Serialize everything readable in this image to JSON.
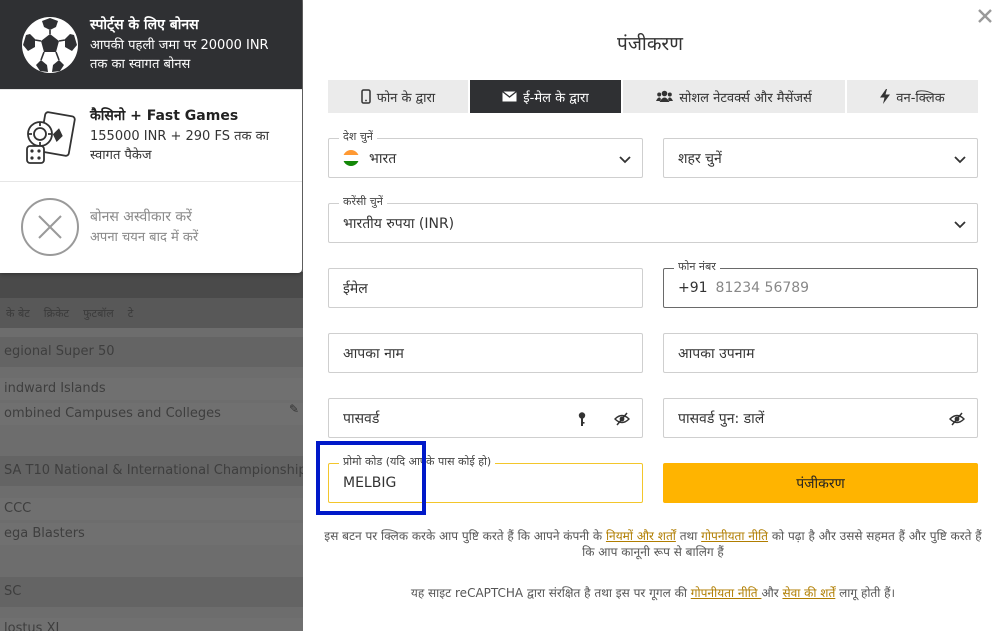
{
  "background": {
    "nav": [
      "के बेट",
      "क्रिकेट",
      "फुटबॉल",
      "टे"
    ],
    "rows": [
      {
        "type": "head",
        "text": "egional Super 50"
      },
      {
        "type": "item",
        "text": "indward Islands"
      },
      {
        "type": "item",
        "text": "ombined Campuses and Colleges"
      },
      {
        "type": "head",
        "text": "SA T10 National & International Championship"
      },
      {
        "type": "item",
        "text": "CCC"
      },
      {
        "type": "item",
        "text": "ega Blasters"
      },
      {
        "type": "head",
        "text": "SC"
      },
      {
        "type": "item",
        "text": "lostus XI"
      }
    ]
  },
  "bonus_panel": {
    "items": [
      {
        "title": "स्पोर्ट्स के लिए बोनस",
        "desc1": "आपकी पहली जमा पर 20000 INR",
        "desc2": "तक का स्वागत बोनस",
        "icon": "soccer-ball-icon",
        "active": true
      },
      {
        "title": "कैसिनो + Fast Games",
        "desc1": "155000 INR + 290 FS तक का",
        "desc2": "स्वागत पैकेज",
        "icon": "casino-icon",
        "active": false
      },
      {
        "title": "बोनस अस्वीकार करें",
        "desc1": "अपना चयन बाद में करें",
        "icon": "decline-x-icon",
        "active": false
      }
    ]
  },
  "modal": {
    "title": "पंजीकरण",
    "tabs": [
      {
        "label": "फोन के द्वारा",
        "icon": "phone-icon"
      },
      {
        "label": "ई-मेल के द्वारा",
        "icon": "envelope-icon",
        "active": true
      },
      {
        "label": "सोशल नेटवर्क्स और मैसेंजर्स",
        "icon": "users-icon"
      },
      {
        "label": "वन-क्लिक",
        "icon": "lightning-icon"
      }
    ],
    "fields": {
      "country": {
        "label": "देश चुनें",
        "value": "भारत"
      },
      "city": {
        "placeholder": "शहर चुनें"
      },
      "currency": {
        "label": "करेंसी चुनें",
        "value": "भारतीय रुपया (INR)"
      },
      "email": {
        "placeholder": "ईमेल"
      },
      "phone": {
        "label": "फोन नंबर",
        "prefix": "+91",
        "placeholder": "81234 56789"
      },
      "first_name": {
        "placeholder": "आपका नाम"
      },
      "last_name": {
        "placeholder": "आपका उपनाम"
      },
      "password": {
        "placeholder": "पासवर्ड"
      },
      "password_repeat": {
        "placeholder": "पासवर्ड पुन: डालें"
      },
      "promo": {
        "label": "प्रोमो कोड (यदि आपके पास कोई हो)",
        "value": "MELBIG"
      }
    },
    "register_button": "पंजीकरण",
    "consent": {
      "t1": "इस बटन पर क्लिक करके आप पुष्टि करते हैं कि आपने कंपनी के ",
      "link1": "नियमों और शर्तों",
      "t2": " तथा ",
      "link2": "गोपनीयता नीति",
      "t3": " को पढ़ा है और उससे सहमत हैं और पुष्टि करते हैं कि आप कानूनी रूप से बालिग हैं"
    },
    "captcha": {
      "t1": "यह साइट reCAPTCHA द्वारा संरक्षित है तथा इस पर गूगल की ",
      "link1": "गोपनीयता नीति ",
      "t2": "और ",
      "link2": "सेवा की शर्तें",
      "t3": " लागू होती हैं।"
    }
  },
  "colors": {
    "accent": "#ffb400",
    "dark_tab": "#2f3033",
    "highlight_box": "#0019c9",
    "link": "#b07d00"
  }
}
